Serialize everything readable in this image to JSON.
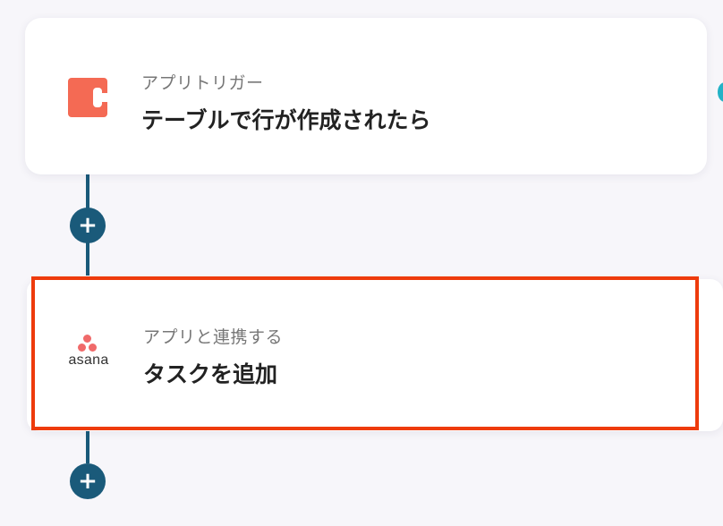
{
  "flow": {
    "trigger": {
      "subtitle": "アプリトリガー",
      "title": "テーブルで行が作成されたら",
      "app_icon": "coda-icon"
    },
    "action": {
      "subtitle": "アプリと連携する",
      "title": "タスクを追加",
      "app_icon": "asana-icon",
      "app_wordmark": "asana",
      "highlighted": true
    },
    "add_step_symbol": "+"
  },
  "colors": {
    "connector": "#1a5a7a",
    "highlight": "#ee3b0c",
    "coda": "#f46a54",
    "asana": "#f06a6a"
  }
}
